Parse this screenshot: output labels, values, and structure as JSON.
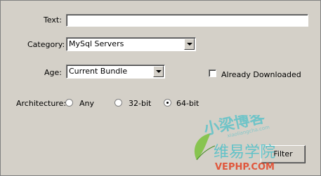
{
  "form": {
    "text_label": "Text:",
    "text_value": "",
    "category_label": "Category:",
    "category_value": "MySql Servers",
    "age_label": "Age:",
    "age_value": "Current Bundle",
    "already_downloaded_label": "Already Downloaded",
    "already_downloaded_checked": false,
    "architecture_label": "Architecture:",
    "architecture_options": [
      "Any",
      "32-bit",
      "64-bit"
    ],
    "architecture_selected": "64-bit",
    "filter_label": "Filter"
  },
  "watermark": {
    "top_text": "小梁博客",
    "url_text": "xiaoliangcha.com",
    "bottom_text": "维易学院",
    "brand_text": "VEPHP.COM"
  },
  "colors": {
    "watermark_teal": "#4fc0c8",
    "watermark_green": "#7fc243",
    "watermark_red": "#e24a2d"
  }
}
